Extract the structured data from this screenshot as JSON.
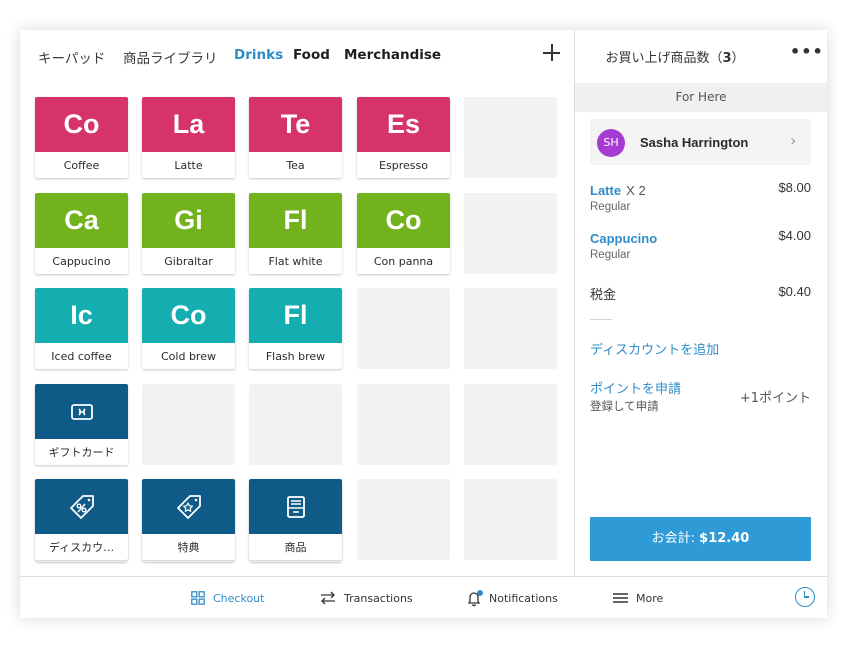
{
  "colors": {
    "accent": "#2e8dc9",
    "pink": "#d6336c",
    "green": "#72b21c",
    "teal": "#14aeb0",
    "navy": "#0f5a86",
    "avatar": "#a63bd4",
    "charge_button": "#2e9ad6"
  },
  "tabs": [
    {
      "label": "キーパッド",
      "active": false
    },
    {
      "label": "商品ライブラリ",
      "active": false
    },
    {
      "label": "Drinks",
      "active": true
    },
    {
      "label": "Food",
      "active": false
    },
    {
      "label": "Merchandise",
      "active": false
    }
  ],
  "tiles": [
    {
      "abbr": "Co",
      "name": "Coffee",
      "color": "pink"
    },
    {
      "abbr": "La",
      "name": "Latte",
      "color": "pink"
    },
    {
      "abbr": "Te",
      "name": "Tea",
      "color": "pink"
    },
    {
      "abbr": "Es",
      "name": "Espresso",
      "color": "pink"
    },
    {
      "abbr": "Ca",
      "name": "Cappucino",
      "color": "green"
    },
    {
      "abbr": "Gi",
      "name": "Gibraltar",
      "color": "green"
    },
    {
      "abbr": "Fl",
      "name": "Flat white",
      "color": "green"
    },
    {
      "abbr": "Co",
      "name": "Con panna",
      "color": "green"
    },
    {
      "abbr": "Ic",
      "name": "Iced coffee",
      "color": "teal"
    },
    {
      "abbr": "Co",
      "name": "Cold brew",
      "color": "teal"
    },
    {
      "abbr": "Fl",
      "name": "Flash brew",
      "color": "teal"
    }
  ],
  "special_tiles": [
    {
      "name": "ギフトカード",
      "icon": "gift-card-icon"
    },
    {
      "name": "ディスカウ…",
      "icon": "discount-tag-icon"
    },
    {
      "name": "特典",
      "icon": "reward-tag-icon"
    },
    {
      "name": "商品",
      "icon": "item-drawer-icon"
    }
  ],
  "sale": {
    "title_prefix": "お買い上げ商品数（",
    "count": "3",
    "title_suffix": "）",
    "more_label": "•••",
    "dining_option": "For Here",
    "customer": {
      "initials": "SH",
      "name": "Sasha Harrington"
    },
    "lines": [
      {
        "item": "Latte",
        "qty": "X 2",
        "variant": "Regular",
        "price": "$8.00"
      },
      {
        "item": "Cappucino",
        "qty": "",
        "variant": "Regular",
        "price": "$4.00"
      }
    ],
    "tax_label": "税金",
    "tax_value": "$0.40",
    "add_discount": "ディスカウントを追加",
    "points_link": "ポイントを申請",
    "points_sub": "登録して申請",
    "points_value": "+1ポイント",
    "charge_prefix": "お会計: ",
    "charge_total": "$12.40"
  },
  "bottom_nav": [
    {
      "label": "Checkout",
      "icon": "grid-icon",
      "active": true
    },
    {
      "label": "Transactions",
      "icon": "swap-arrows-icon",
      "active": false
    },
    {
      "label": "Notifications",
      "icon": "bell-icon",
      "active": false
    },
    {
      "label": "More",
      "icon": "menu-lines-icon",
      "active": false
    }
  ]
}
